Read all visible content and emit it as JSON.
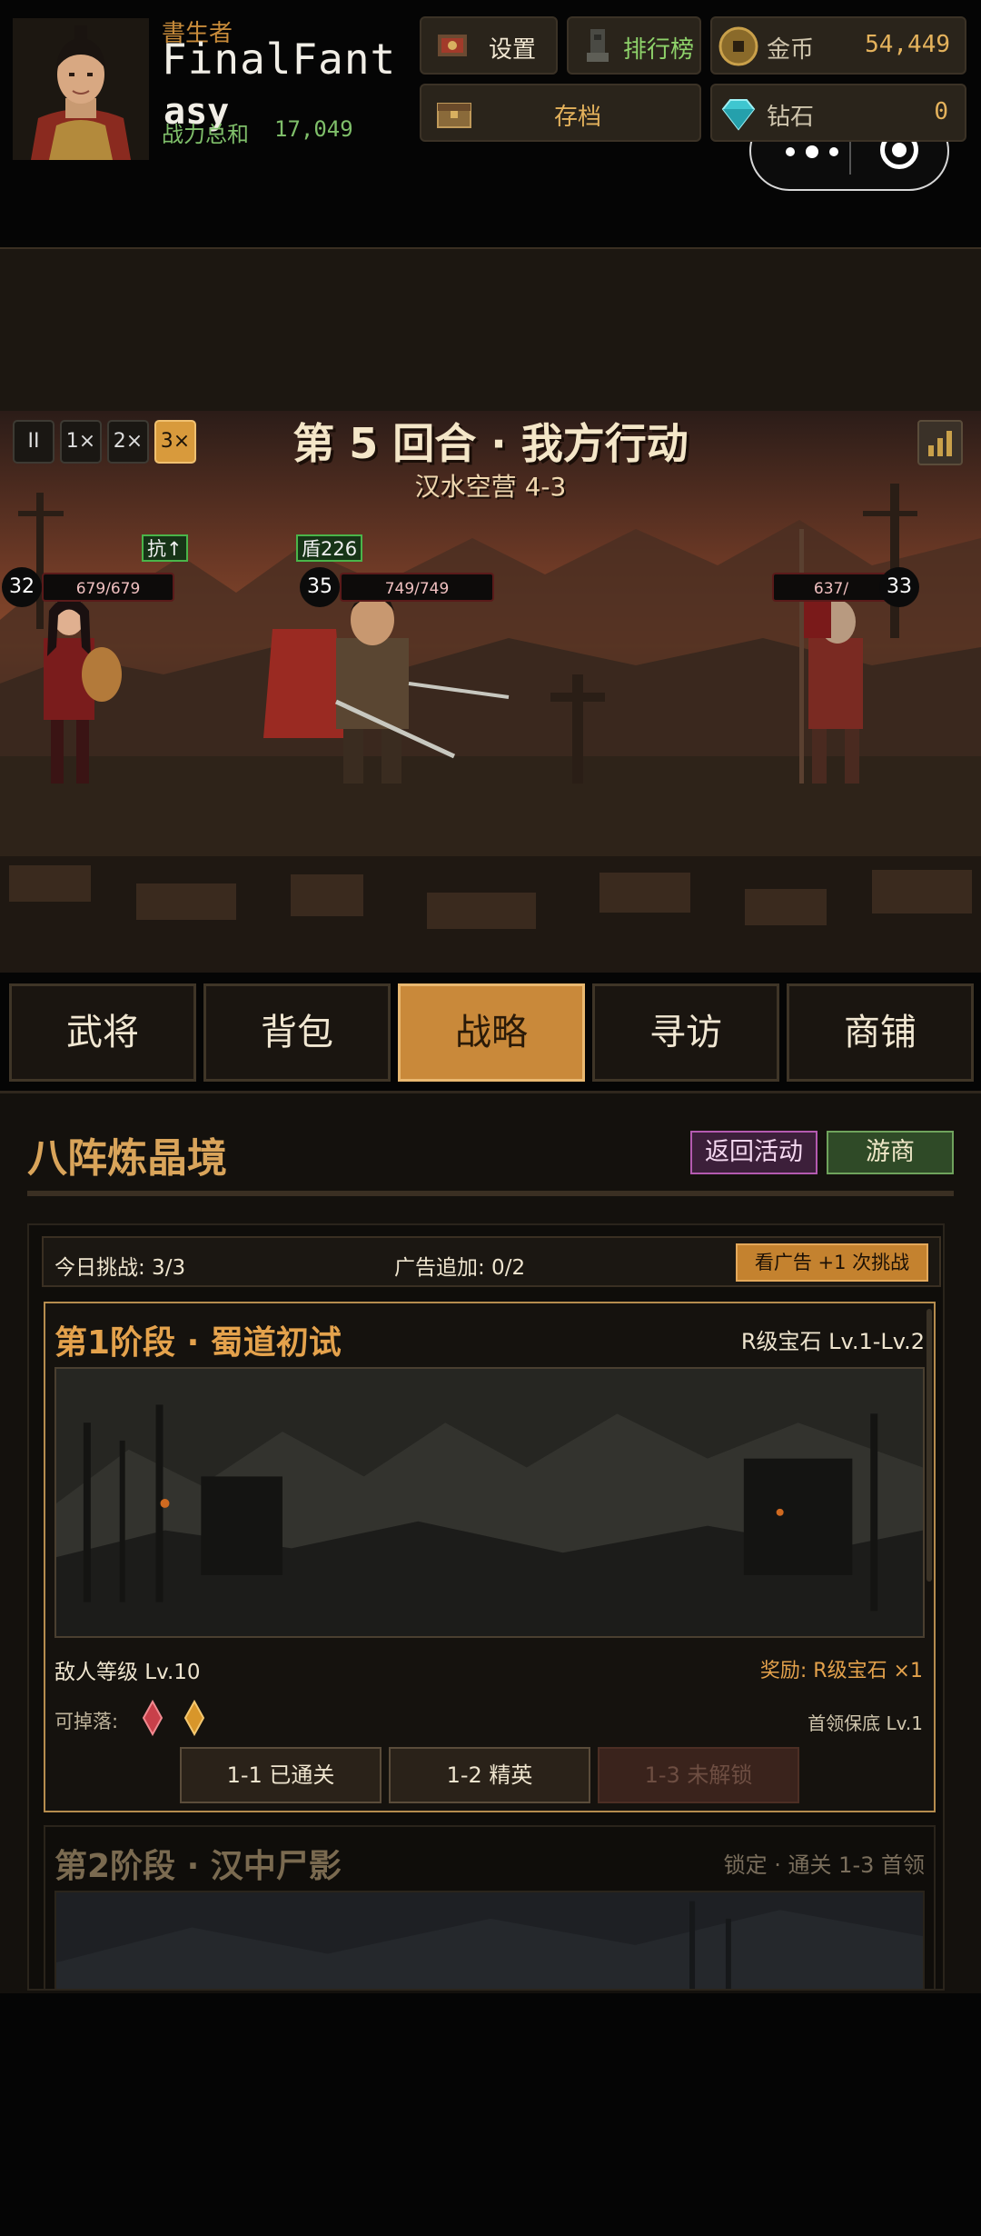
{
  "header": {
    "player_title": "書生者",
    "player_name": "FinalFant",
    "player_name_line2": "asy",
    "power_label": "战力总和",
    "power_value": "17,049",
    "settings_label": "设置",
    "rank_label": "排行榜",
    "gold_label": "金币",
    "gold_value": "54,449",
    "save_label": "存档",
    "diamond_label": "钻石",
    "diamond_value": "0"
  },
  "battle": {
    "speed_buttons": [
      "II",
      "1×",
      "2×",
      "3×"
    ],
    "active_speed": "3×",
    "round_title": "第 5 回合 · 我方行动",
    "stage_label": "汉水空营 4-3",
    "units": [
      {
        "level": "32",
        "hp": "679/679",
        "buff": "抗↑"
      },
      {
        "level": "35",
        "hp": "749/749",
        "buff": "盾226"
      },
      {
        "level": "33",
        "hp": "637/"
      }
    ]
  },
  "tabs": [
    "武将",
    "背包",
    "战略",
    "寻访",
    "商铺"
  ],
  "active_tab": "战略",
  "panel": {
    "section_title": "八阵炼晶境",
    "return_label": "返回活动",
    "merchant_label": "游商",
    "challenge_today": "今日挑战: 3/3",
    "ad_extra": "广告追加: 0/2",
    "ad_button": "看广告 +1 次挑战",
    "stage1": {
      "title": "第1阶段 · 蜀道初试",
      "reward_range": "R级宝石 Lv.1-Lv.2",
      "enemy_level": "敌人等级 Lv.10",
      "reward": "奖励: R级宝石 ×1",
      "drop_label": "可掉落:",
      "boss_guarantee": "首领保底 Lv.1",
      "buttons": [
        {
          "label": "1-1  已通关",
          "locked": false
        },
        {
          "label": "1-2  精英",
          "locked": false
        },
        {
          "label": "1-3  未解锁",
          "locked": true
        }
      ]
    },
    "stage2": {
      "title": "第2阶段 · 汉中尸影",
      "lock_text": "锁定 · 通关 1-3 首领"
    }
  }
}
